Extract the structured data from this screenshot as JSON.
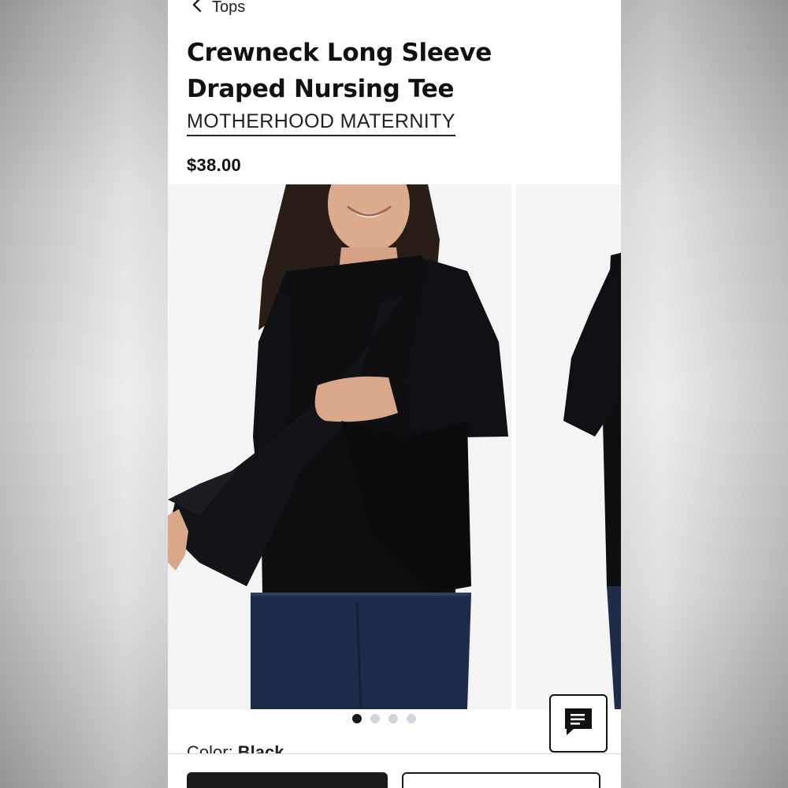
{
  "breadcrumb": {
    "label": "Tops",
    "icon": "chevron-left-icon"
  },
  "product": {
    "title": "Crewneck Long Sleeve Draped Nursing Tee",
    "brand": "MOTHERHOOD MATERNITY",
    "price": "$38.00",
    "color_label": "Color:",
    "color_value": "Black"
  },
  "gallery": {
    "image_count": 4,
    "active_index": 0
  },
  "chat": {
    "icon": "chat-message-icon"
  },
  "colors": {
    "garment": "#0f0f12",
    "jeans": "#1e2c4a",
    "skin": "#d9a88a",
    "hair": "#2a1d17",
    "background": "#f4f4f4",
    "dot_active": "#1a1a1a",
    "dot_inactive": "#cfd6dd"
  }
}
